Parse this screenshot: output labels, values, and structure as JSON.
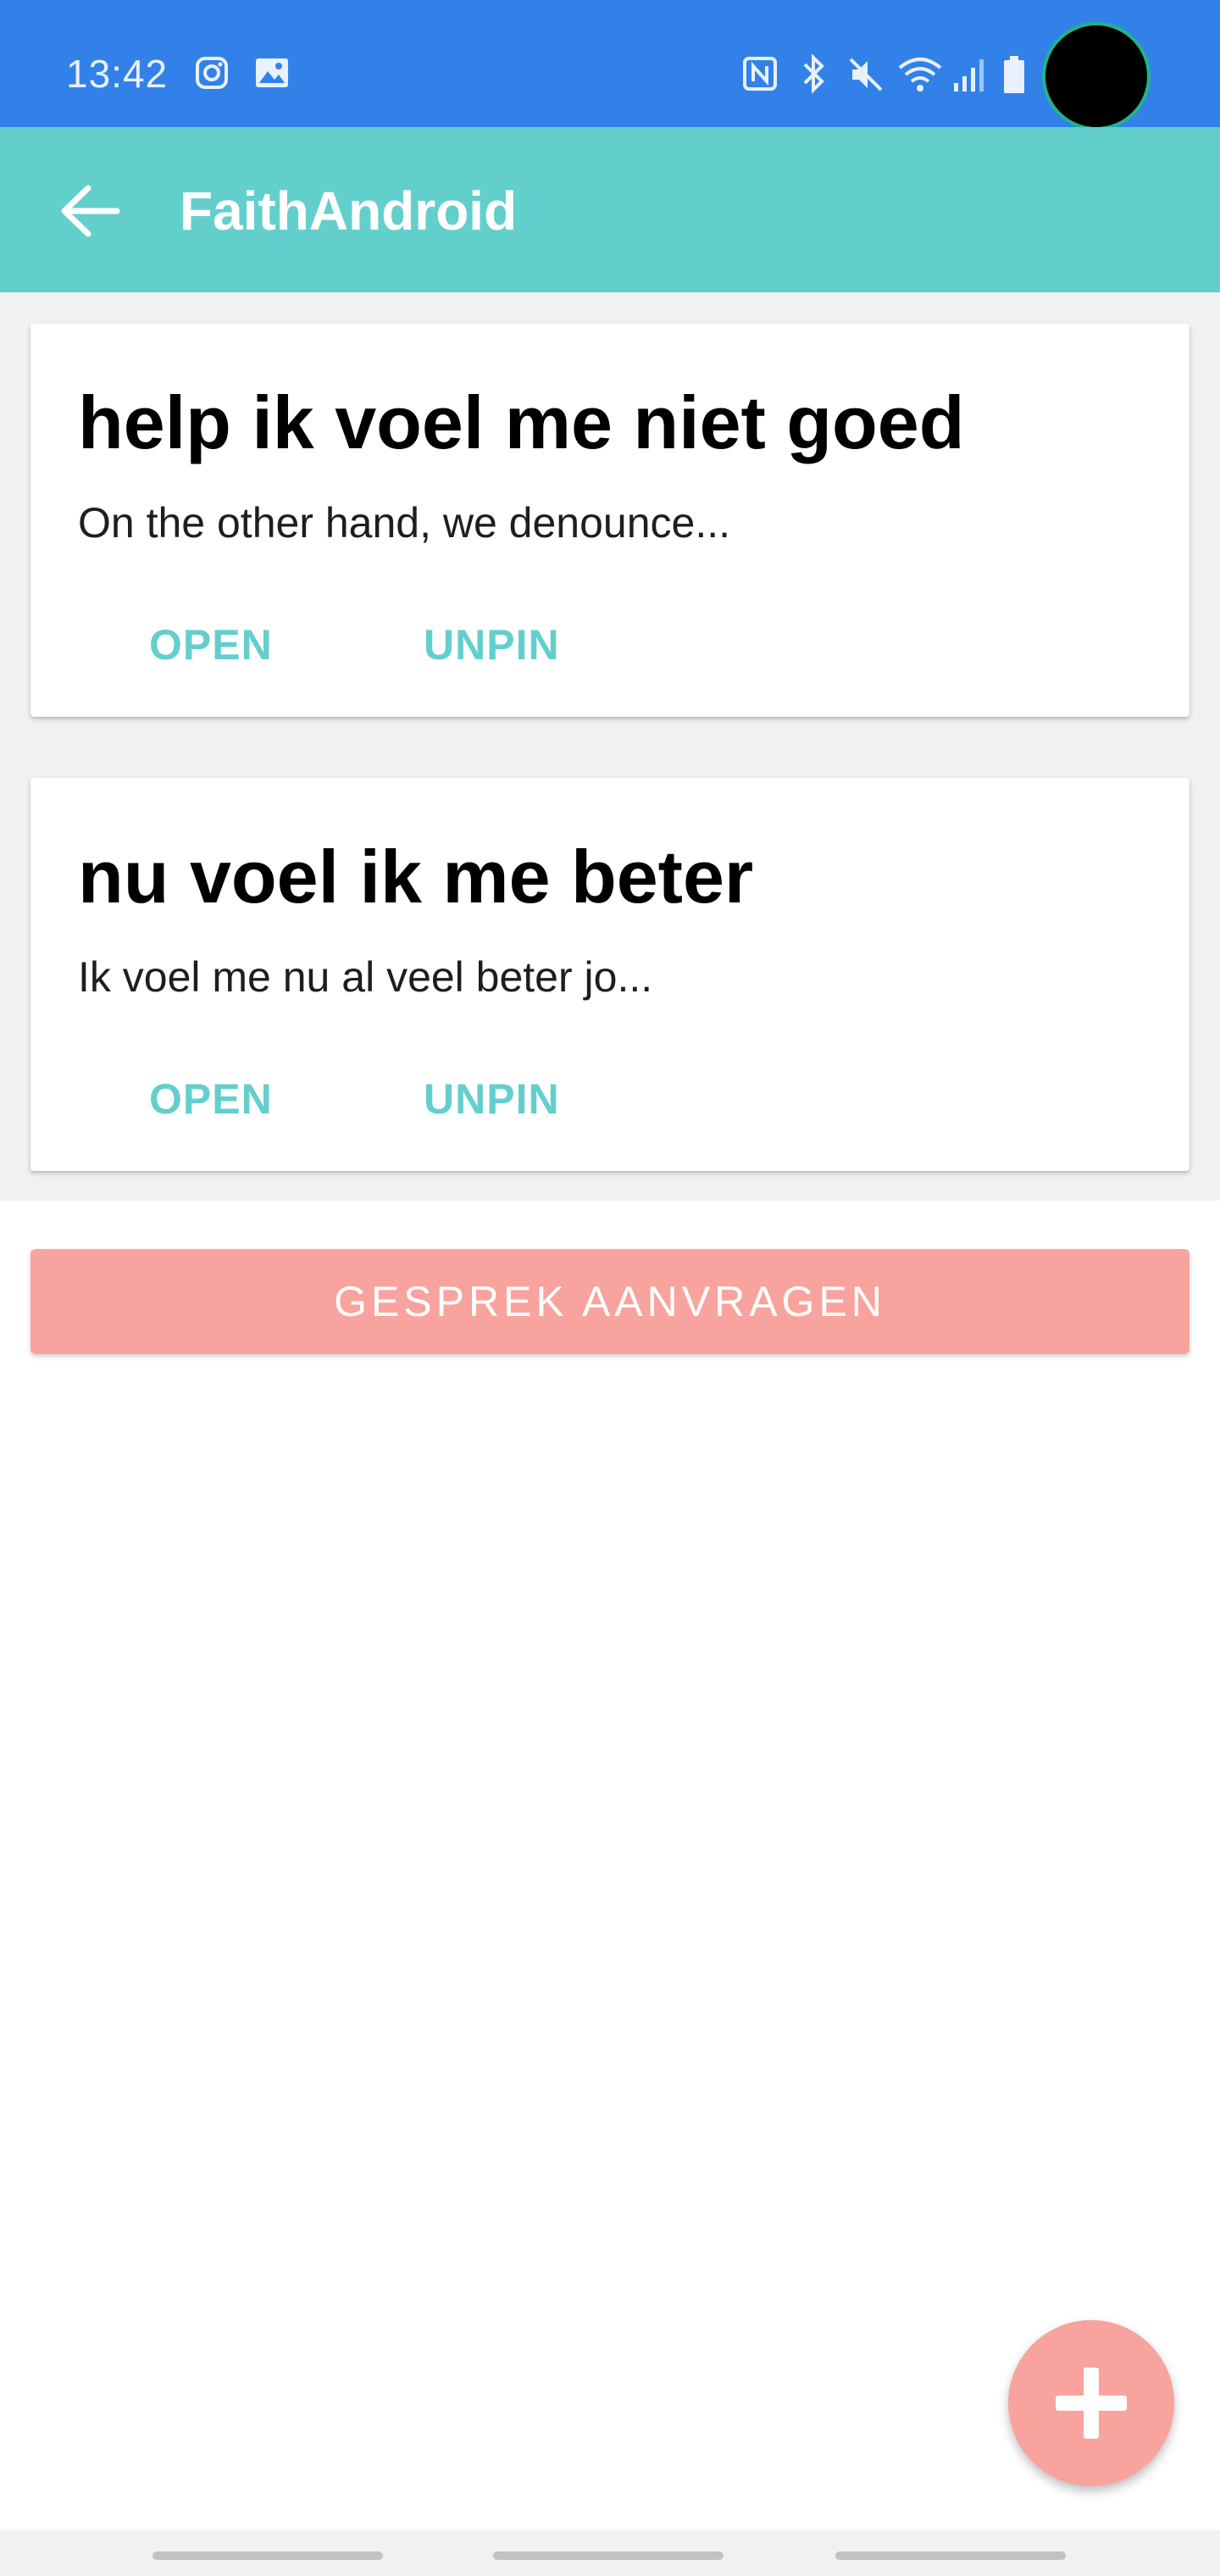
{
  "status_bar": {
    "time": "13:42",
    "left_icons": [
      "instagram-icon",
      "gallery-icon"
    ],
    "right_icons": [
      "nfc-icon",
      "bluetooth-icon",
      "mute-icon",
      "wifi-icon",
      "signal-icon",
      "battery-icon"
    ]
  },
  "app_bar": {
    "title": "FaithAndroid",
    "back_icon": "arrow-left-icon"
  },
  "cards": [
    {
      "title": "help ik voel me niet goed",
      "subtitle": "On the other hand, we denounce...",
      "open_label": "OPEN",
      "unpin_label": "UNPIN"
    },
    {
      "title": "nu voel ik me beter",
      "subtitle": "Ik voel me nu al veel beter jo...",
      "open_label": "OPEN",
      "unpin_label": "UNPIN"
    }
  ],
  "request_button": {
    "label": "GESPREK AANVRAGEN"
  },
  "fab": {
    "icon": "plus-icon"
  },
  "colors": {
    "status_bar": "#3281e9",
    "app_bar": "#63cfcd",
    "accent_text": "#63cfcd",
    "button": "#f8a39d"
  }
}
